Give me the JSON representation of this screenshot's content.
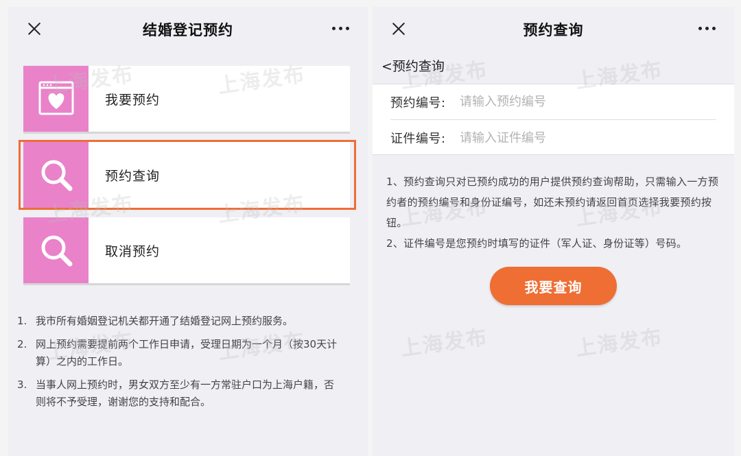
{
  "left": {
    "title": "结婚登记预约",
    "cards": [
      {
        "label": "我要预约",
        "icon": "calendar-heart-icon"
      },
      {
        "label": "预约查询",
        "icon": "search-icon"
      },
      {
        "label": "取消预约",
        "icon": "search-icon"
      }
    ],
    "notes": [
      {
        "num": "1.",
        "text": "我市所有婚姻登记机关都开通了结婚登记网上预约服务。"
      },
      {
        "num": "2.",
        "text": "网上预约需要提前两个工作日申请，受理日期为一个月（按30天计算）之内的工作日。"
      },
      {
        "num": "3.",
        "text": "当事人网上预约时，男女双方至少有一方常驻户口为上海户籍，否则将不予受理，谢谢您的支持和配合。"
      }
    ]
  },
  "right": {
    "title": "预约查询",
    "back_label": "<预约查询",
    "fields": [
      {
        "label": "预约编号:",
        "value": "",
        "placeholder": "请输入预约编号"
      },
      {
        "label": "证件编号:",
        "value": "",
        "placeholder": "请输入证件编号"
      }
    ],
    "notes": [
      "1、预约查询只对已预约成功的用户提供预约查询帮助，只需输入一方预约者的预约编号和身份证编号，如还未预约请返回首页选择我要预约按钮。",
      "2、证件编号是您预约时填写的证件（军人证、身份证等）号码。"
    ],
    "button_label": "我要查询"
  },
  "watermark": "上海发布",
  "colors": {
    "accent_pink": "#e982c9",
    "accent_orange": "#ee6e34",
    "panel_bg": "#efeff4"
  }
}
